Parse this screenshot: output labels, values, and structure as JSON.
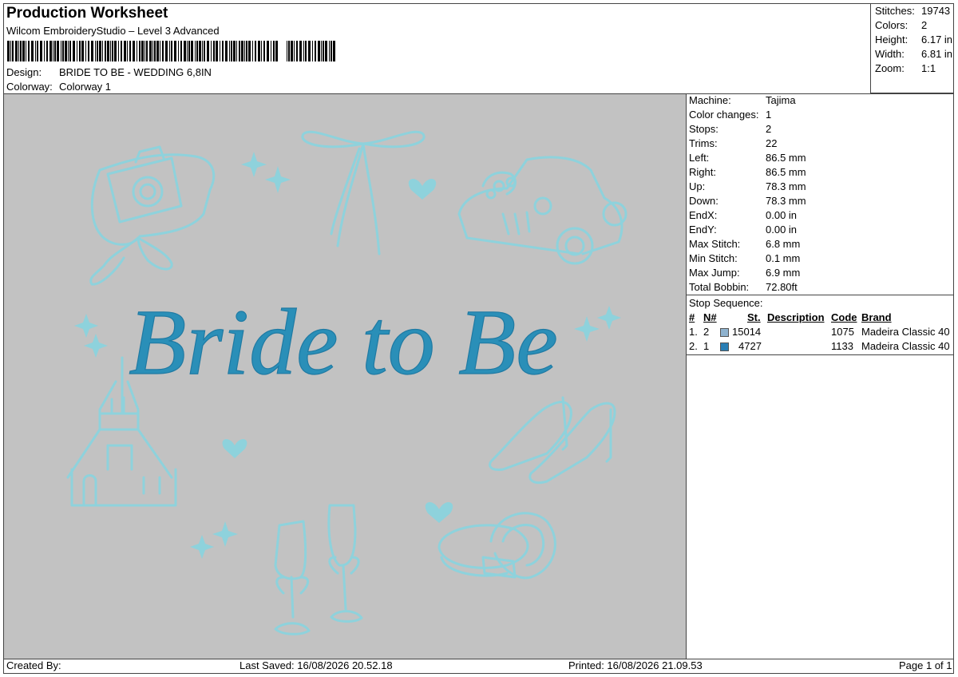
{
  "header": {
    "title": "Production Worksheet",
    "software": "Wilcom EmbroideryStudio – Level 3 Advanced",
    "design_label": "Design:",
    "design_value": "BRIDE TO BE - WEDDING 6,8IN",
    "colorway_label": "Colorway:",
    "colorway_value": "Colorway 1"
  },
  "stats": [
    {
      "label": "Stitches:",
      "value": "19743"
    },
    {
      "label": "Colors:",
      "value": "2"
    },
    {
      "label": "Height:",
      "value": "6.17 in"
    },
    {
      "label": "Width:",
      "value": "6.81 in"
    },
    {
      "label": "Zoom:",
      "value": "1:1"
    }
  ],
  "design_text": "Bride to Be",
  "properties": [
    {
      "label": "Machine:",
      "value": "Tajima"
    },
    {
      "label": "Color changes:",
      "value": "1"
    },
    {
      "label": "Stops:",
      "value": "2"
    },
    {
      "label": "Trims:",
      "value": "22"
    },
    {
      "label": "Left:",
      "value": "86.5 mm"
    },
    {
      "label": "Right:",
      "value": "86.5 mm"
    },
    {
      "label": "Up:",
      "value": "78.3 mm"
    },
    {
      "label": "Down:",
      "value": "78.3 mm"
    },
    {
      "label": "EndX:",
      "value": "0.00 in"
    },
    {
      "label": "EndY:",
      "value": "0.00 in"
    },
    {
      "label": "Max Stitch:",
      "value": "6.8 mm"
    },
    {
      "label": "Min Stitch:",
      "value": "0.1 mm"
    },
    {
      "label": "Max Jump:",
      "value": "6.9 mm"
    },
    {
      "label": "Total Bobbin:",
      "value": "72.80ft"
    }
  ],
  "stop_sequence": {
    "title": "Stop Sequence:",
    "headers": {
      "num": "#",
      "n": "N#",
      "st": "St.",
      "desc": "Description",
      "code": "Code",
      "brand": "Brand"
    },
    "rows": [
      {
        "num": "1.",
        "n": "2",
        "color": "#8fb3cf",
        "st": "15014",
        "desc": "",
        "code": "1075",
        "brand": "Madeira Classic 40"
      },
      {
        "num": "2.",
        "n": "1",
        "color": "#2a7fb5",
        "st": "4727",
        "desc": "",
        "code": "1133",
        "brand": "Madeira Classic 40"
      }
    ]
  },
  "footer": {
    "created_by": "Created By:",
    "last_saved": "Last Saved: 16/08/2026 20.52.18",
    "printed": "Printed: 16/08/2026 21.09.53",
    "page": "Page 1 of 1"
  },
  "colors": {
    "canvas_bg": "#c2c2c2",
    "thread_light": "#8ed2dc",
    "thread_dark": "#2a8fb8"
  }
}
